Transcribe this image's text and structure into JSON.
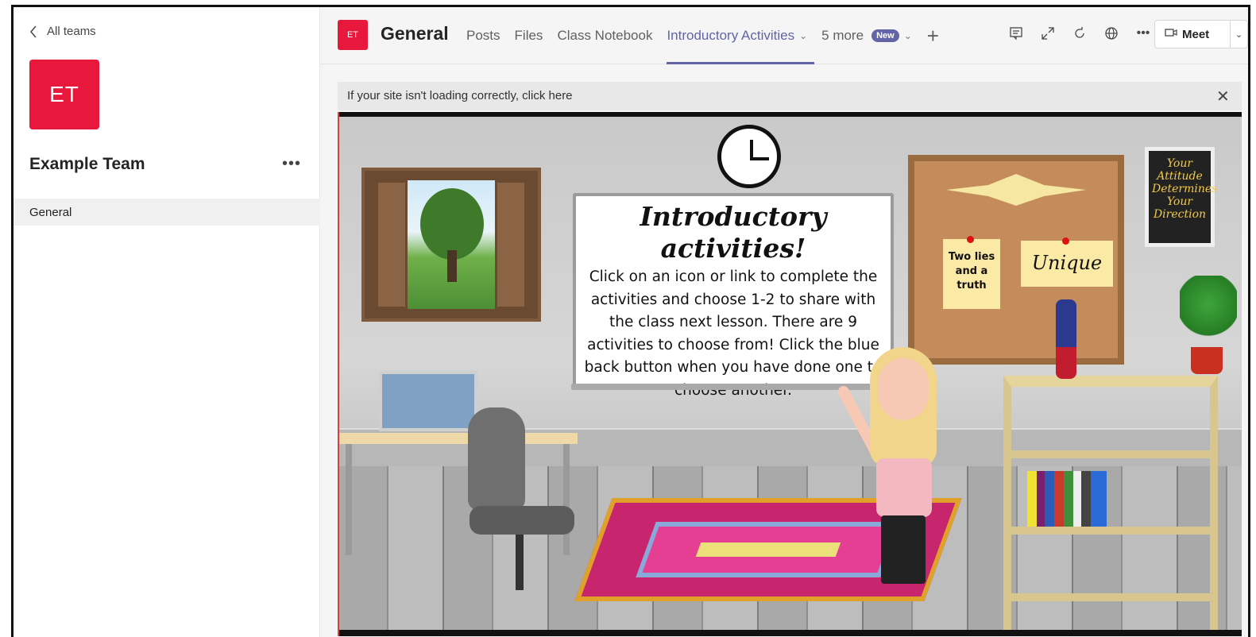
{
  "sidebar": {
    "back_label": "All teams",
    "team_initials": "ET",
    "team_name": "Example Team",
    "more_label": "•••",
    "channels": [
      {
        "label": "General",
        "selected": true
      }
    ]
  },
  "header": {
    "channel_initials": "ET",
    "channel_title": "General",
    "tabs": [
      {
        "label": "Posts"
      },
      {
        "label": "Files"
      },
      {
        "label": "Class Notebook"
      },
      {
        "label": "Introductory Activities",
        "active": true,
        "dropdown": true
      }
    ],
    "more_tabs_label": "5 more",
    "new_badge": "New",
    "add_tab_icon": "plus-icon",
    "toolbar_icons": [
      "conversation-icon",
      "expand-icon",
      "refresh-icon",
      "globe-icon",
      "more-icon"
    ],
    "meet_label": "Meet",
    "accent_color": "#6264a7",
    "team_color": "#e8173c"
  },
  "banner": {
    "text": "If your site isn't loading correctly, click here",
    "close_icon": "close-icon"
  },
  "classroom": {
    "board_title": "Introductory activities!",
    "board_text": "Click on an icon or link to complete the activities and choose 1-2 to share with the class next lesson. There are 9 activities to choose from! Click the blue back button when you have done one to choose another.",
    "note_left": "Two lies and a truth",
    "note_right": "Unique",
    "poster_text": "Your Attitude Determines Your Direction"
  }
}
